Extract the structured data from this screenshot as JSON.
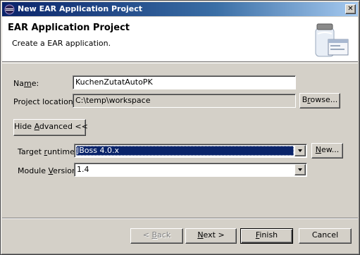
{
  "window": {
    "title": "New EAR Application Project",
    "close_glyph": "✕"
  },
  "banner": {
    "heading": "EAR Application Project",
    "description": "Create a EAR application.",
    "icon": "jar-icon"
  },
  "form": {
    "name_label_prefix": "Na",
    "name_label_mnemonic": "m",
    "name_label_suffix": "e:",
    "name_value": "KuchenZutatAutoPK",
    "location_label": "Project location:",
    "location_value": "C:\\temp\\workspace",
    "browse_prefix": "B",
    "browse_mnemonic": "r",
    "browse_suffix": "owse...",
    "advanced_prefix": "Hide ",
    "advanced_mnemonic": "A",
    "advanced_suffix": "dvanced <<",
    "runtime_label_prefix": "Target ",
    "runtime_label_mnemonic": "r",
    "runtime_label_suffix": "untime:",
    "runtime_value": "JBoss 4.0.x",
    "new_prefix": "",
    "new_mnemonic": "N",
    "new_suffix": "ew...",
    "module_label_prefix": "Module ",
    "module_label_mnemonic": "V",
    "module_label_suffix": "ersion:",
    "module_value": "1.4"
  },
  "footer": {
    "back_prefix": "< ",
    "back_mnemonic": "B",
    "back_suffix": "ack",
    "next_prefix": "",
    "next_mnemonic": "N",
    "next_suffix": "ext >",
    "finish_prefix": "",
    "finish_mnemonic": "F",
    "finish_suffix": "inish",
    "cancel_label": "Cancel"
  }
}
